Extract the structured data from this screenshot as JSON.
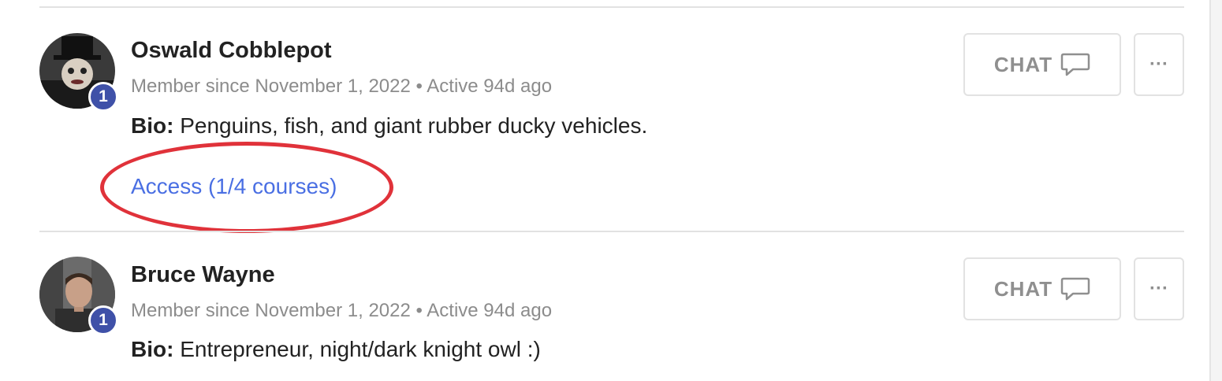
{
  "members": [
    {
      "name": "Oswald Cobblepot",
      "badge": "1",
      "member_since": "Member since November 1, 2022",
      "separator": "•",
      "active": "Active 94d ago",
      "bio_label": "Bio:",
      "bio_text": "Penguins, fish, and giant rubber ducky vehicles.",
      "access_link": "Access (1/4 courses)",
      "chat_label": "CHAT",
      "more_label": "···"
    },
    {
      "name": "Bruce Wayne",
      "badge": "1",
      "member_since": "Member since November 1, 2022",
      "separator": "•",
      "active": "Active 94d ago",
      "bio_label": "Bio:",
      "bio_text": "Entrepreneur, night/dark knight owl :)",
      "chat_label": "CHAT",
      "more_label": "···"
    }
  ],
  "colors": {
    "badge": "#3f51a8",
    "link": "#4a6fe3",
    "annotation": "#e0323a"
  }
}
